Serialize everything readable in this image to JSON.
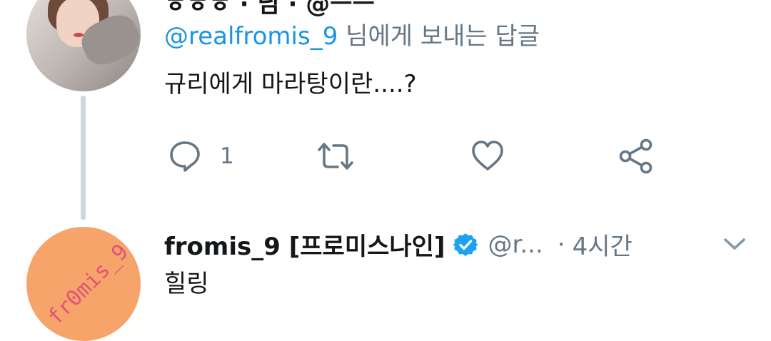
{
  "tweet1": {
    "cropped_header_text": "ㅎㅎㅎ · 님 · @ㅡㅡ",
    "reply_to_handle": "@realfromis_9",
    "reply_to_suffix": " 님에게 보내는 답글",
    "text": "규리에게 마라탕이란....?",
    "reply_count": "1"
  },
  "tweet2": {
    "display_name": "fromis_9 [프로미스나인]",
    "handle": "@r...",
    "dot": "·",
    "time": "4시간",
    "text": "힐링",
    "avatar_text": "fr0mis_9"
  },
  "colors": {
    "link": "#1b95e0",
    "secondary": "#657786",
    "verified": "#1da1f2",
    "thread_line": "#cdd6dd",
    "avatar2_bg": "#f6a46a"
  },
  "icons": [
    "reply-icon",
    "retweet-icon",
    "like-icon",
    "share-icon",
    "verified-badge-icon",
    "chevron-down-icon"
  ]
}
